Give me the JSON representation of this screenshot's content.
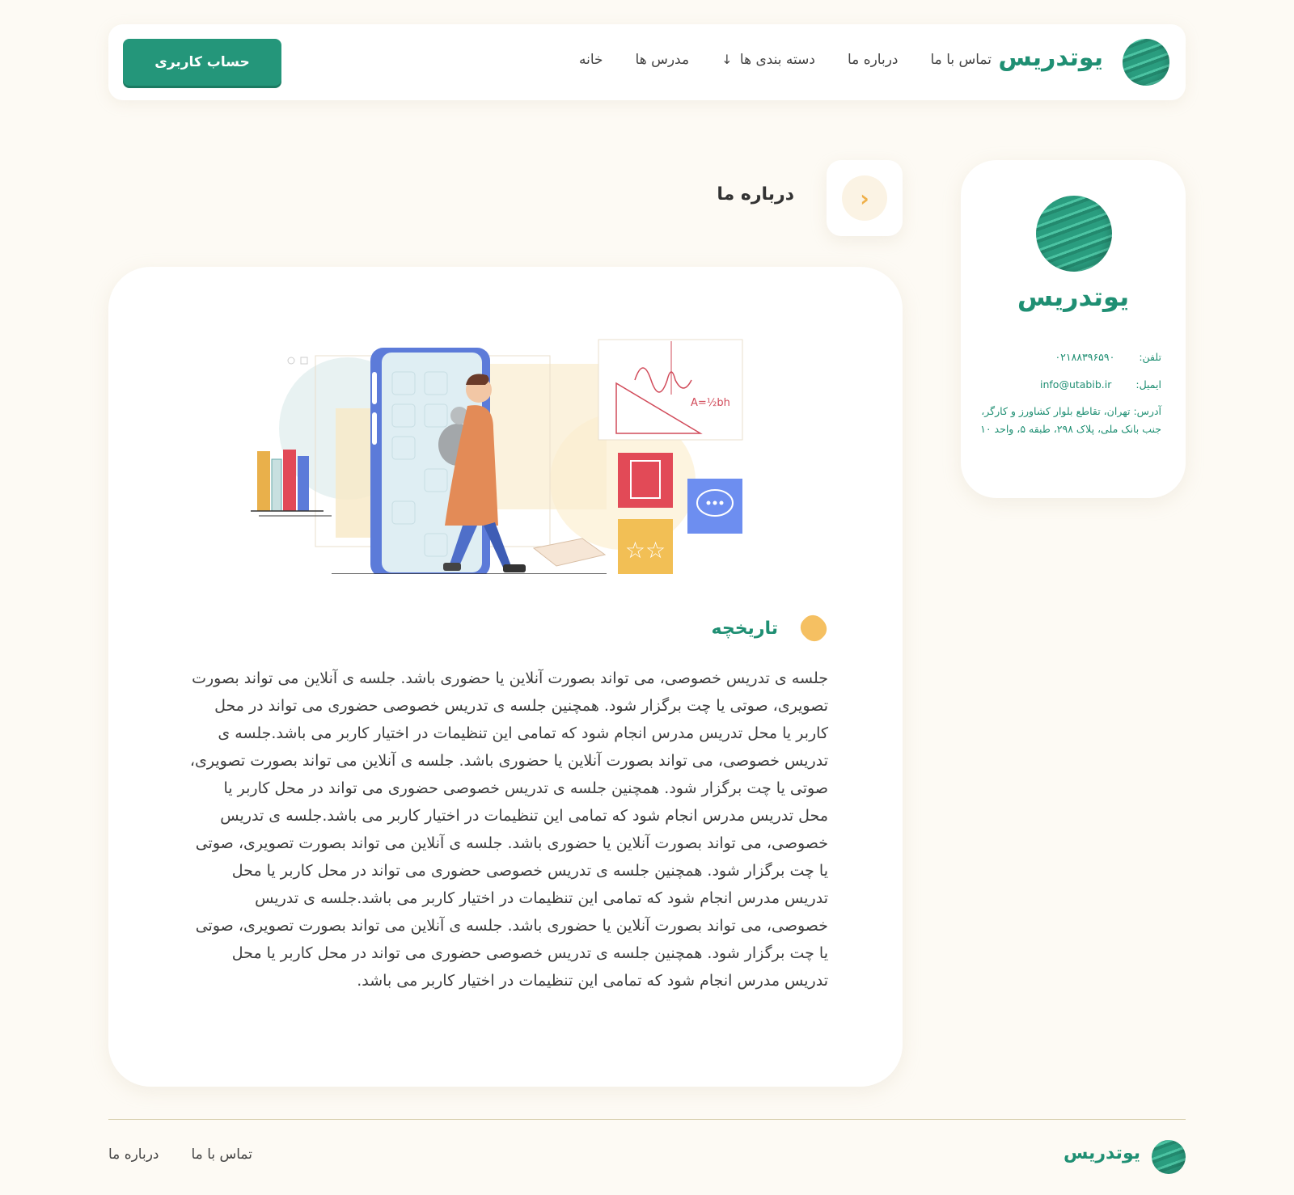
{
  "header": {
    "logo_text": "یوتدریس",
    "nav": [
      {
        "label": "خانه"
      },
      {
        "label": "مدرس ها"
      },
      {
        "label": "دسته بندی ها",
        "arrow": "↓"
      },
      {
        "label": "درباره ما"
      },
      {
        "label": "تماس با ما"
      }
    ],
    "account_button": "حساب کاربری"
  },
  "info_card": {
    "logo_text": "یوتدریس",
    "phone_label": "تلفن:",
    "phone_value": "۰۲۱۸۸۳۹۶۵۹۰",
    "email_label": "ایمیل:",
    "email_value": "info@utabib.ir",
    "address": "آدرس: تهران، تقاطع بلوار کشاورز و کارگر، جنب بانک ملی، پلاک ۲۹۸، طبقه ۵، واحد ۱۰"
  },
  "page": {
    "back_icon": "chevron-right-icon",
    "title": "درباره ما"
  },
  "section": {
    "title": "تاریخچه",
    "body": "جلسه ی تدریس خصوصی، می تواند بصورت آنلاین یا حضوری باشد. جلسه ی آنلاین می تواند بصورت تصویری، صوتی یا چت برگزار شود. همچنین جلسه ی تدریس خصوصی حضوری می تواند در محل کاربر یا محل تدریس مدرس انجام شود که تمامی این تنظیمات در اختیار کاربر می باشد.جلسه ی تدریس خصوصی، می تواند بصورت آنلاین یا حضوری باشد. جلسه ی آنلاین می تواند بصورت تصویری، صوتی یا چت برگزار شود. همچنین جلسه ی تدریس خصوصی حضوری می تواند در محل کاربر یا محل تدریس مدرس انجام شود که تمامی این تنظیمات در اختیار کاربر می باشد.جلسه ی تدریس خصوصی، می تواند بصورت آنلاین یا حضوری باشد. جلسه ی آنلاین می تواند بصورت تصویری، صوتی یا چت برگزار شود. همچنین جلسه ی تدریس خصوصی حضوری می تواند در محل کاربر یا محل تدریس مدرس انجام شود که تمامی این تنظیمات در اختیار کاربر می باشد.جلسه ی تدریس خصوصی، می تواند بصورت آنلاین یا حضوری باشد. جلسه ی آنلاین می تواند بصورت تصویری، صوتی یا چت برگزار شود. همچنین جلسه ی تدریس خصوصی حضوری می تواند در محل کاربر یا محل تدریس مدرس انجام شود که تمامی این تنظیمات در اختیار کاربر می باشد."
  },
  "illustration": {
    "formula": "A=½bh"
  },
  "footer": {
    "logo_text": "یوتدریس",
    "links": [
      {
        "label": "درباره ما"
      },
      {
        "label": "تماس با ما"
      }
    ]
  },
  "colors": {
    "brand": "#24967a",
    "accent": "#f5c062",
    "background": "#fdfaf4"
  }
}
